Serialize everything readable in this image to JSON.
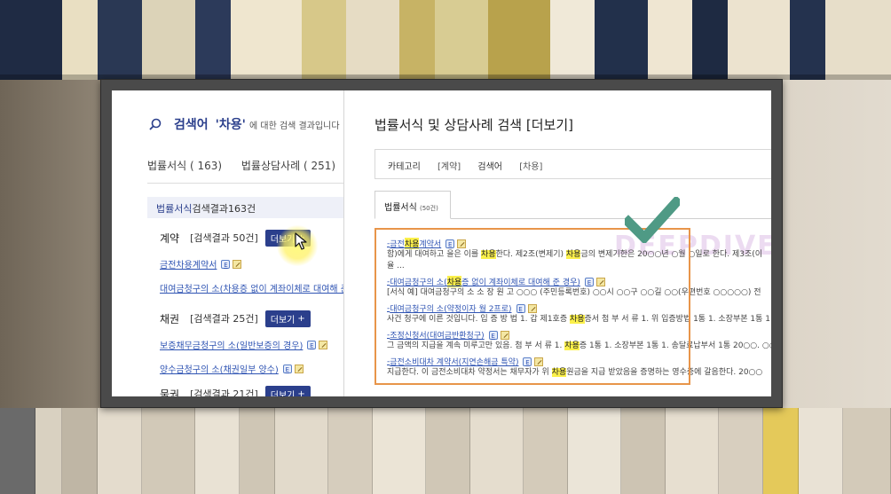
{
  "left_panel": {
    "search_label": "검색어",
    "keyword": "'차용'",
    "suffix": "에 대한 검색 결과입니다",
    "categories": [
      "법률서식 ( 163)",
      "법률상담사례 ( 251)"
    ],
    "result_bar": {
      "type": "법률서식",
      "text": "검색결과163건"
    },
    "groups": [
      {
        "name": "계약",
        "count": "[검색결과 50건]",
        "more_label": "더보기",
        "items": [
          "금전차용계약서",
          "대여금청구의 소(차용증 없이 계좌이체로 대여해 준"
        ]
      },
      {
        "name": "채권",
        "count": "[검색결과 25건]",
        "more_label": "더보기",
        "items": [
          "보증채무금청구의 소(일반보증의 경우)",
          "양수금청구의 소(채권일부 양수)"
        ]
      },
      {
        "name": "물권",
        "count": "[검색결과 21건]",
        "more_label": "더보기",
        "items": []
      }
    ]
  },
  "right_panel": {
    "title": "법률서식 및 상담사례 검색 [더보기]",
    "category_label": "카테고리",
    "category_value": "[계약]",
    "keyword_label": "검색어",
    "keyword_value": "[차용]",
    "tab_label": "법률서식",
    "tab_count": "(50건)",
    "results": [
      {
        "title_pre": "금전",
        "title_hl": "차용",
        "title_post": "계약서",
        "text_pre": "함)에게 대여하고 을은 이를 ",
        "text_hl": "차용",
        "text_post": "한다. 제2조(변제기) ",
        "text_hl2": "차용",
        "text_post2": "금의 변제기한은 20○○년 ○월 ○일로 한다. 제3조(이",
        "text_extra": "율 ..."
      },
      {
        "title_pre": "대여금청구의 소(",
        "title_hl": "차용",
        "title_post": "증 없이 계좌이체로 대여해 준 경우)",
        "text_pre": "[서식 예] 대여금청구의 소 소 장 원 고 ○○○ (주민등록번호) ○○시 ○○구 ○○길 ○○(우편번호 ○○○○○) 전",
        "text_hl": "",
        "text_post": "",
        "text_hl2": "",
        "text_post2": "",
        "text_extra": ""
      },
      {
        "title_pre": "대여금청구의 소(약정이자 월 2프로)",
        "title_hl": "",
        "title_post": "",
        "text_pre": "사건 청구에 이른 것입니다. 입 증 방 법 1. 갑 제1호증 ",
        "text_hl": "차용",
        "text_post": "증서 첨 부 서 류 1. 위 입증방법 1통 1. 소장부본 1통 1.",
        "text_hl2": "",
        "text_post2": "",
        "text_extra": ""
      },
      {
        "title_pre": "조정신청서(대여금반환청구)",
        "title_hl": "",
        "title_post": "",
        "text_pre": "그 금액의 지급을 계속 미루고만 있음. 첨 부 서 류 1. ",
        "text_hl": "차용",
        "text_post": "증 1통 1. 소장부본 1통 1. 송달료납부서 1통 20○○. ○○",
        "text_hl2": "",
        "text_post2": "",
        "text_extra": ""
      },
      {
        "title_pre": "금전소비대차 계약서(지연손해금 특약)",
        "title_hl": "",
        "title_post": "",
        "text_pre": "지급한다. 이 금전소비대차 약정서는 채무자가 위 ",
        "text_hl": "차용",
        "text_post": "원금을 지급 받았음을 증명하는 영수증에 갈음한다. 20○○",
        "text_hl2": "",
        "text_post2": "",
        "text_extra": ""
      }
    ]
  },
  "watermark": "DEEPDIVE TISTORY",
  "colors": {
    "accent_blue": "#2b3f8c",
    "link_blue": "#2f54b3",
    "highlight": "#fbf04b",
    "orange_box": "#e8954a",
    "check_green": "#4f9a85"
  }
}
